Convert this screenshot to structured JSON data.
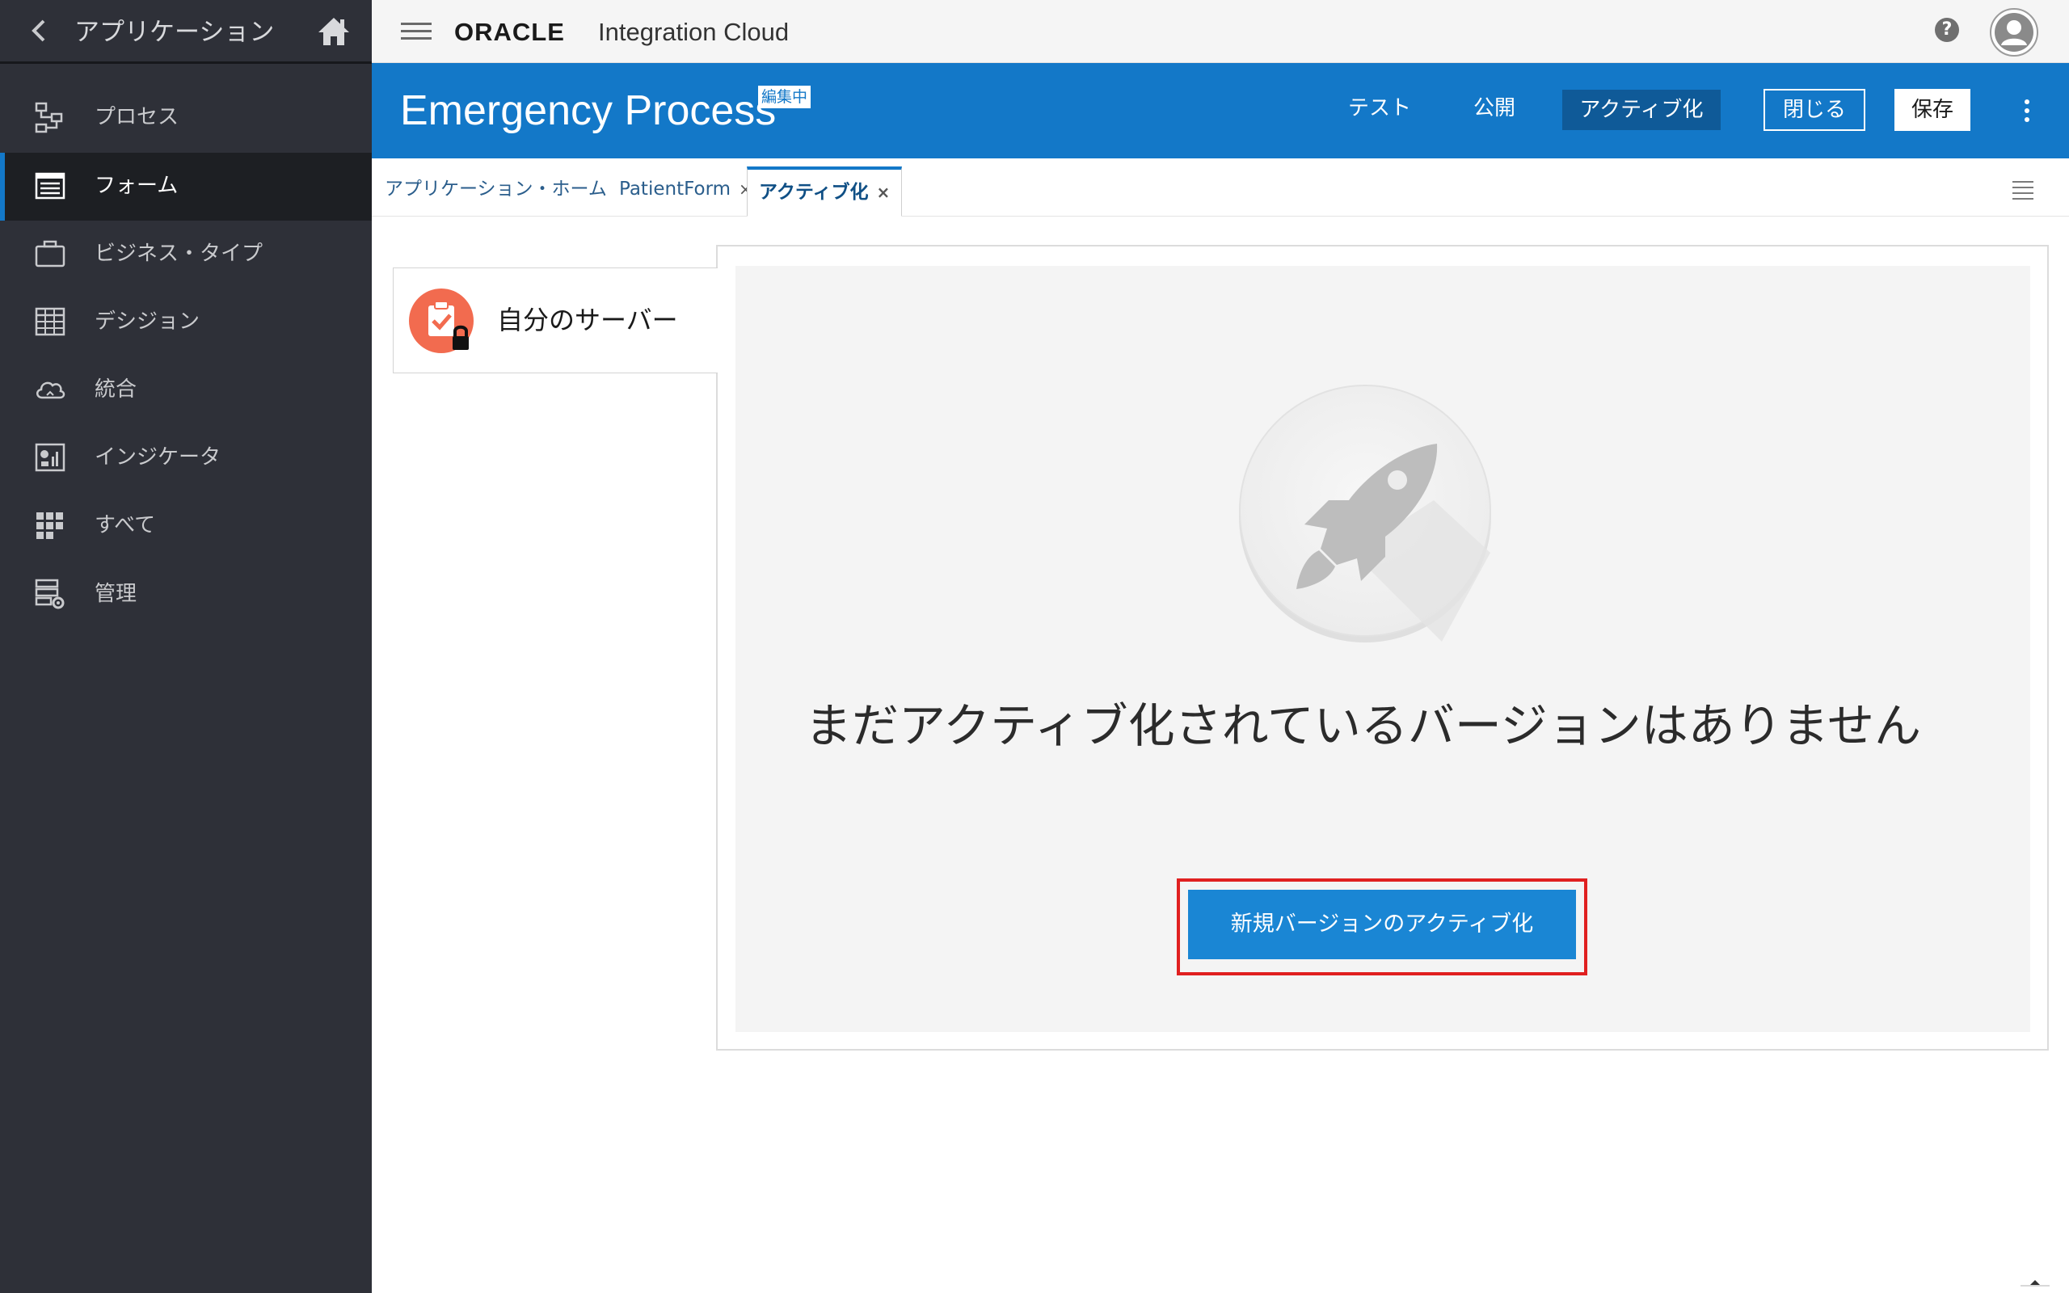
{
  "sidebar": {
    "title": "アプリケーション",
    "items": [
      {
        "label": "プロセス",
        "icon": "process-icon"
      },
      {
        "label": "フォーム",
        "icon": "form-icon",
        "active": true
      },
      {
        "label": "ビジネス・タイプ",
        "icon": "briefcase-icon"
      },
      {
        "label": "デシジョン",
        "icon": "table-icon"
      },
      {
        "label": "統合",
        "icon": "cloud-icon"
      },
      {
        "label": "インジケータ",
        "icon": "chart-icon"
      },
      {
        "label": "すべて",
        "icon": "grid-icon"
      },
      {
        "label": "管理",
        "icon": "admin-icon"
      }
    ]
  },
  "topbar": {
    "brand": "ORACLE",
    "product": "Integration Cloud",
    "help_label": "?"
  },
  "process": {
    "title": "Emergency Process",
    "badge": "編集中",
    "test_label": "テスト",
    "publish_label": "公開",
    "activate_label": "アクティブ化",
    "close_label": "閉じる",
    "save_label": "保存"
  },
  "tabs": [
    {
      "label": "アプリケーション・ホーム",
      "closable": false
    },
    {
      "label": "PatientForm",
      "closable": true
    },
    {
      "label": "アクティブ化",
      "closable": true,
      "active": true
    }
  ],
  "tab_close_glyph": "×",
  "server": {
    "name": "自分のサーバー"
  },
  "main": {
    "empty_message": "まだアクティブ化されているバージョンはありません",
    "activate_new_label": "新規バージョンのアクティブ化"
  },
  "colors": {
    "accent": "#1378c8",
    "sidebar_bg": "#2e3038",
    "highlight": "#e02020",
    "server_icon": "#f26b4f"
  }
}
